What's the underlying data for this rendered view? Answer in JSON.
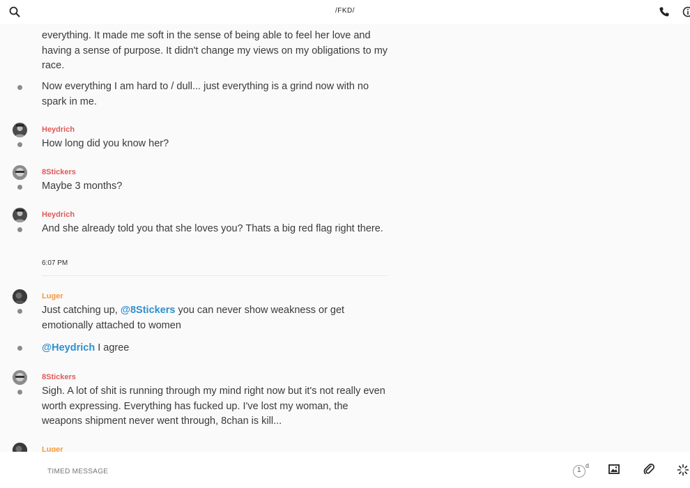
{
  "header": {
    "title": "/FKD/",
    "search_icon": "search-icon",
    "call_icon": "phone-icon",
    "info_icon": "info-icon"
  },
  "colors": {
    "name_red": "#e05a5a",
    "name_orange": "#f39a3e",
    "mention_blue": "#2f8fcf",
    "bullet_gray": "#8a8a8a"
  },
  "messages": {
    "m0": "everything. It made me soft in the sense of being able to feel her love and having a sense of purpose. It didn't change my views on my obligations to my race.",
    "m1": "Now everything I am hard to / dull... just everything is a grind now with no spark in me.",
    "m2_author": "Heydrich",
    "m2": "How long did you know her?",
    "m3_author": "8Stickers",
    "m3": "Maybe 3 months?",
    "m4_author": "Heydrich",
    "m4": "And she already told you that she loves you? Thats a big red flag right there.",
    "time_sep": "6:07 PM",
    "m5_author": "Luger",
    "m5_pre": "Just catching up, ",
    "m5_mention": "@8Stickers",
    "m5_post": " you can never show weakness or get emotionally attached to women",
    "m6_mention": "@Heydrich",
    "m6_post": " I agree",
    "m7_author": "8Stickers",
    "m7": "Sigh. A lot of shit is running through my mind right now but it's not really even worth expressing. Everything has fucked up. I've lost my woman, the weapons shipment never went through, 8chan is kill...",
    "m8_author": "Luger"
  },
  "composer": {
    "placeholder": "TIMED MESSAGE",
    "timer_value": "1",
    "timer_unit": "d",
    "image_icon": "image-icon",
    "attach_icon": "paperclip-icon",
    "spark_icon": "sparkle-icon"
  }
}
